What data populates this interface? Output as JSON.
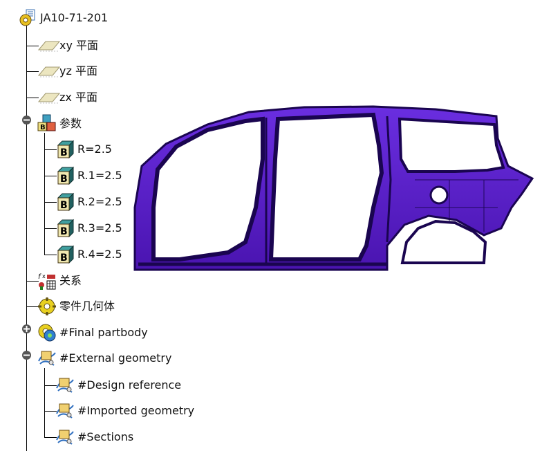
{
  "tree": {
    "root_label": "JA10-71-201",
    "planes": [
      {
        "label": "xy 平面",
        "icon": "plane-icon"
      },
      {
        "label": "yz 平面",
        "icon": "plane-icon"
      },
      {
        "label": "zx 平面",
        "icon": "plane-icon"
      }
    ],
    "parameters": {
      "label": "参数",
      "icon": "parameters-icon",
      "expanded": true,
      "items": [
        {
          "label": "R=2.5",
          "icon": "parameter-b-icon"
        },
        {
          "label": "R.1=2.5",
          "icon": "parameter-b-icon"
        },
        {
          "label": "R.2=2.5",
          "icon": "parameter-b-icon"
        },
        {
          "label": "R.3=2.5",
          "icon": "parameter-b-icon"
        },
        {
          "label": "R.4=2.5",
          "icon": "parameter-b-icon"
        }
      ]
    },
    "relations": {
      "label": "关系",
      "icon": "relations-icon"
    },
    "part_geometry": {
      "label": "零件几何体",
      "icon": "part-body-icon"
    },
    "final_partbody": {
      "label": "#Final partbody",
      "icon": "final-partbody-icon",
      "expanded": false
    },
    "external_geometry": {
      "label": "#External geometry",
      "icon": "geometrical-set-icon",
      "expanded": true,
      "items": [
        {
          "label": "#Design reference",
          "icon": "geometrical-set-icon"
        },
        {
          "label": "#Imported geometry",
          "icon": "geometrical-set-icon"
        },
        {
          "label": "#Sections",
          "icon": "geometrical-set-icon"
        }
      ]
    }
  },
  "colors": {
    "body_side": "#5a1ec8",
    "body_side_dark": "#2a0a70",
    "tree_line": "#000000",
    "plane_icon": "#e8e2b8"
  },
  "viewport": {
    "object": "car-body-side-panel"
  }
}
